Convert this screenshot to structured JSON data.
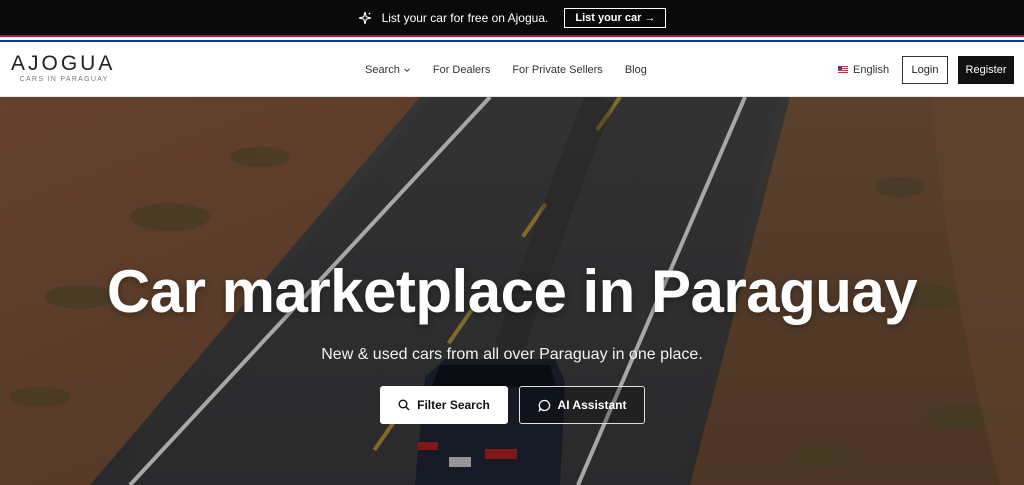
{
  "promo": {
    "text": "List your car for free on Ajogua.",
    "cta_label": "List your car →"
  },
  "header": {
    "logo": {
      "name": "AJOGUA",
      "tagline": "CARS IN PARAGUAY"
    },
    "nav": [
      {
        "label": "Search"
      },
      {
        "label": "For Dealers"
      },
      {
        "label": "For Private Sellers"
      },
      {
        "label": "Blog"
      }
    ],
    "language": "English",
    "login_label": "Login",
    "register_label": "Register"
  },
  "hero": {
    "title": "Car marketplace in Paraguay",
    "subtitle": "New & used cars from all over Paraguay in one place.",
    "filter_button": "Filter Search",
    "ai_button": "AI Assistant"
  },
  "colors": {
    "promo_bg": "#0a0a0a",
    "flag_red": "#c8102e",
    "flag_blue": "#0038a8",
    "register_bg": "#111111"
  }
}
